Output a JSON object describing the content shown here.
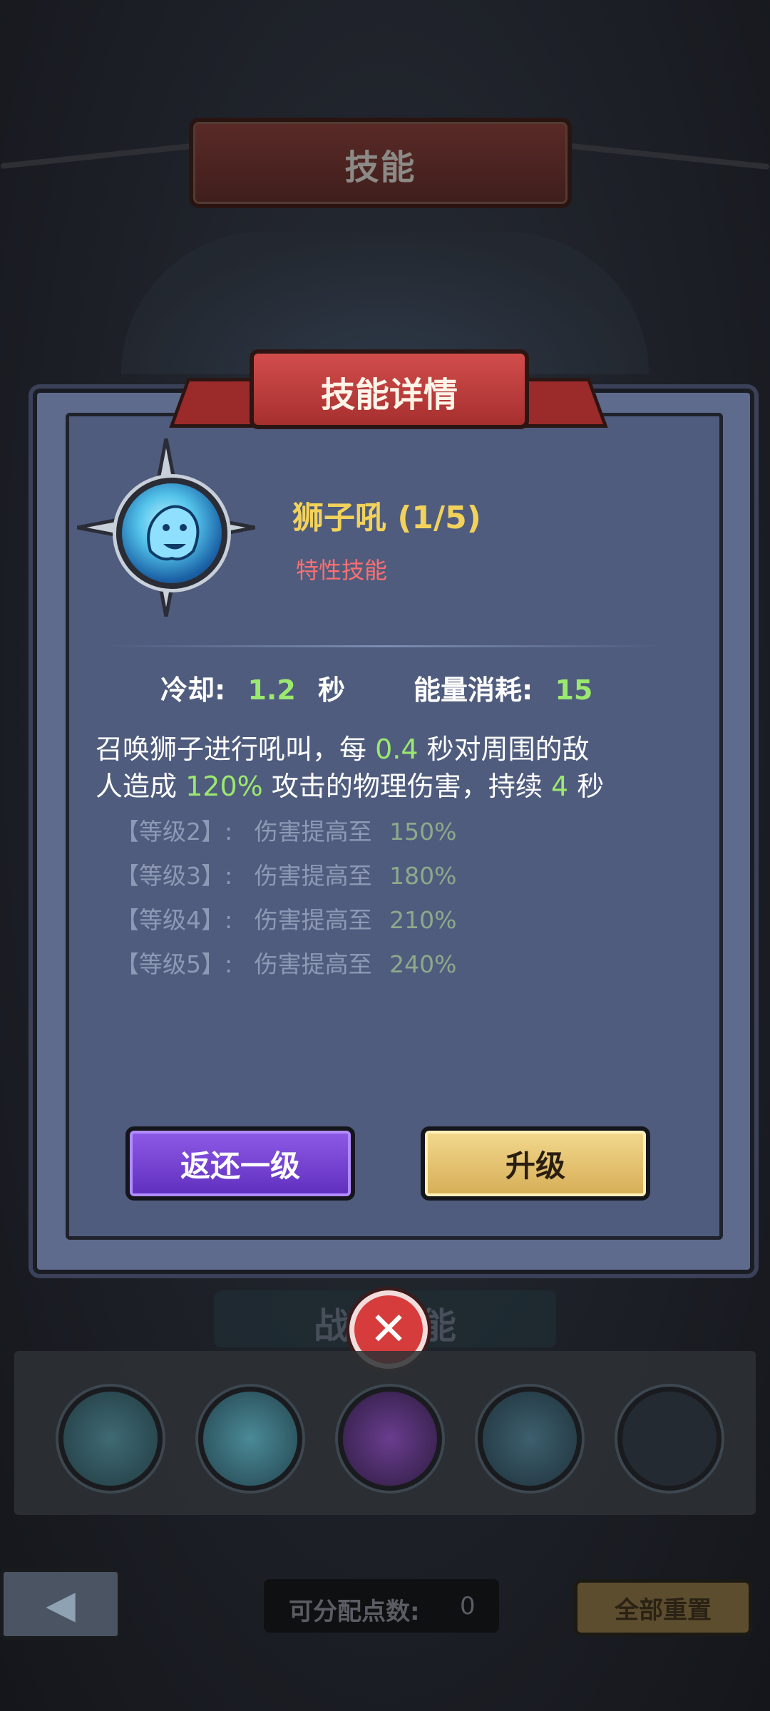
{
  "background": {
    "top_title": "技能",
    "battle_skills_title": "战斗技能",
    "points_label": "可分配点数:",
    "points_value": "0",
    "reset_label": "全部重置"
  },
  "dialog": {
    "title": "技能详情",
    "skill_name": "狮子吼 (1/5)",
    "skill_type": "特性技能",
    "cooldown_label": "冷却:",
    "cooldown_value": "1.2",
    "cooldown_unit": "秒",
    "energy_label": "能量消耗:",
    "energy_value": "15",
    "description": {
      "p1": "召唤狮子进行吼叫，每",
      "v1": "0.4",
      "p2": "秒对周围的敌",
      "p3": "人造成",
      "v2": "120%",
      "p4": "攻击的物理伤害，持续",
      "v3": "4",
      "p5": "秒"
    },
    "levels": [
      {
        "label": "【等级2】:",
        "text": "伤害提高至",
        "value": "150%"
      },
      {
        "label": "【等级3】:",
        "text": "伤害提高至",
        "value": "180%"
      },
      {
        "label": "【等级4】:",
        "text": "伤害提高至",
        "value": "210%"
      },
      {
        "label": "【等级5】:",
        "text": "伤害提高至",
        "value": "240%"
      }
    ],
    "downgrade_label": "返还一级",
    "upgrade_label": "升级",
    "close_symbol": "✕"
  },
  "icons": {
    "skill": "lion-roar-icon",
    "close": "close-icon",
    "back": "back-arrow-icon"
  },
  "colors": {
    "highlight_value": "#9be86f",
    "skill_name": "#f2d25a",
    "skill_type": "#ff6f6f"
  }
}
